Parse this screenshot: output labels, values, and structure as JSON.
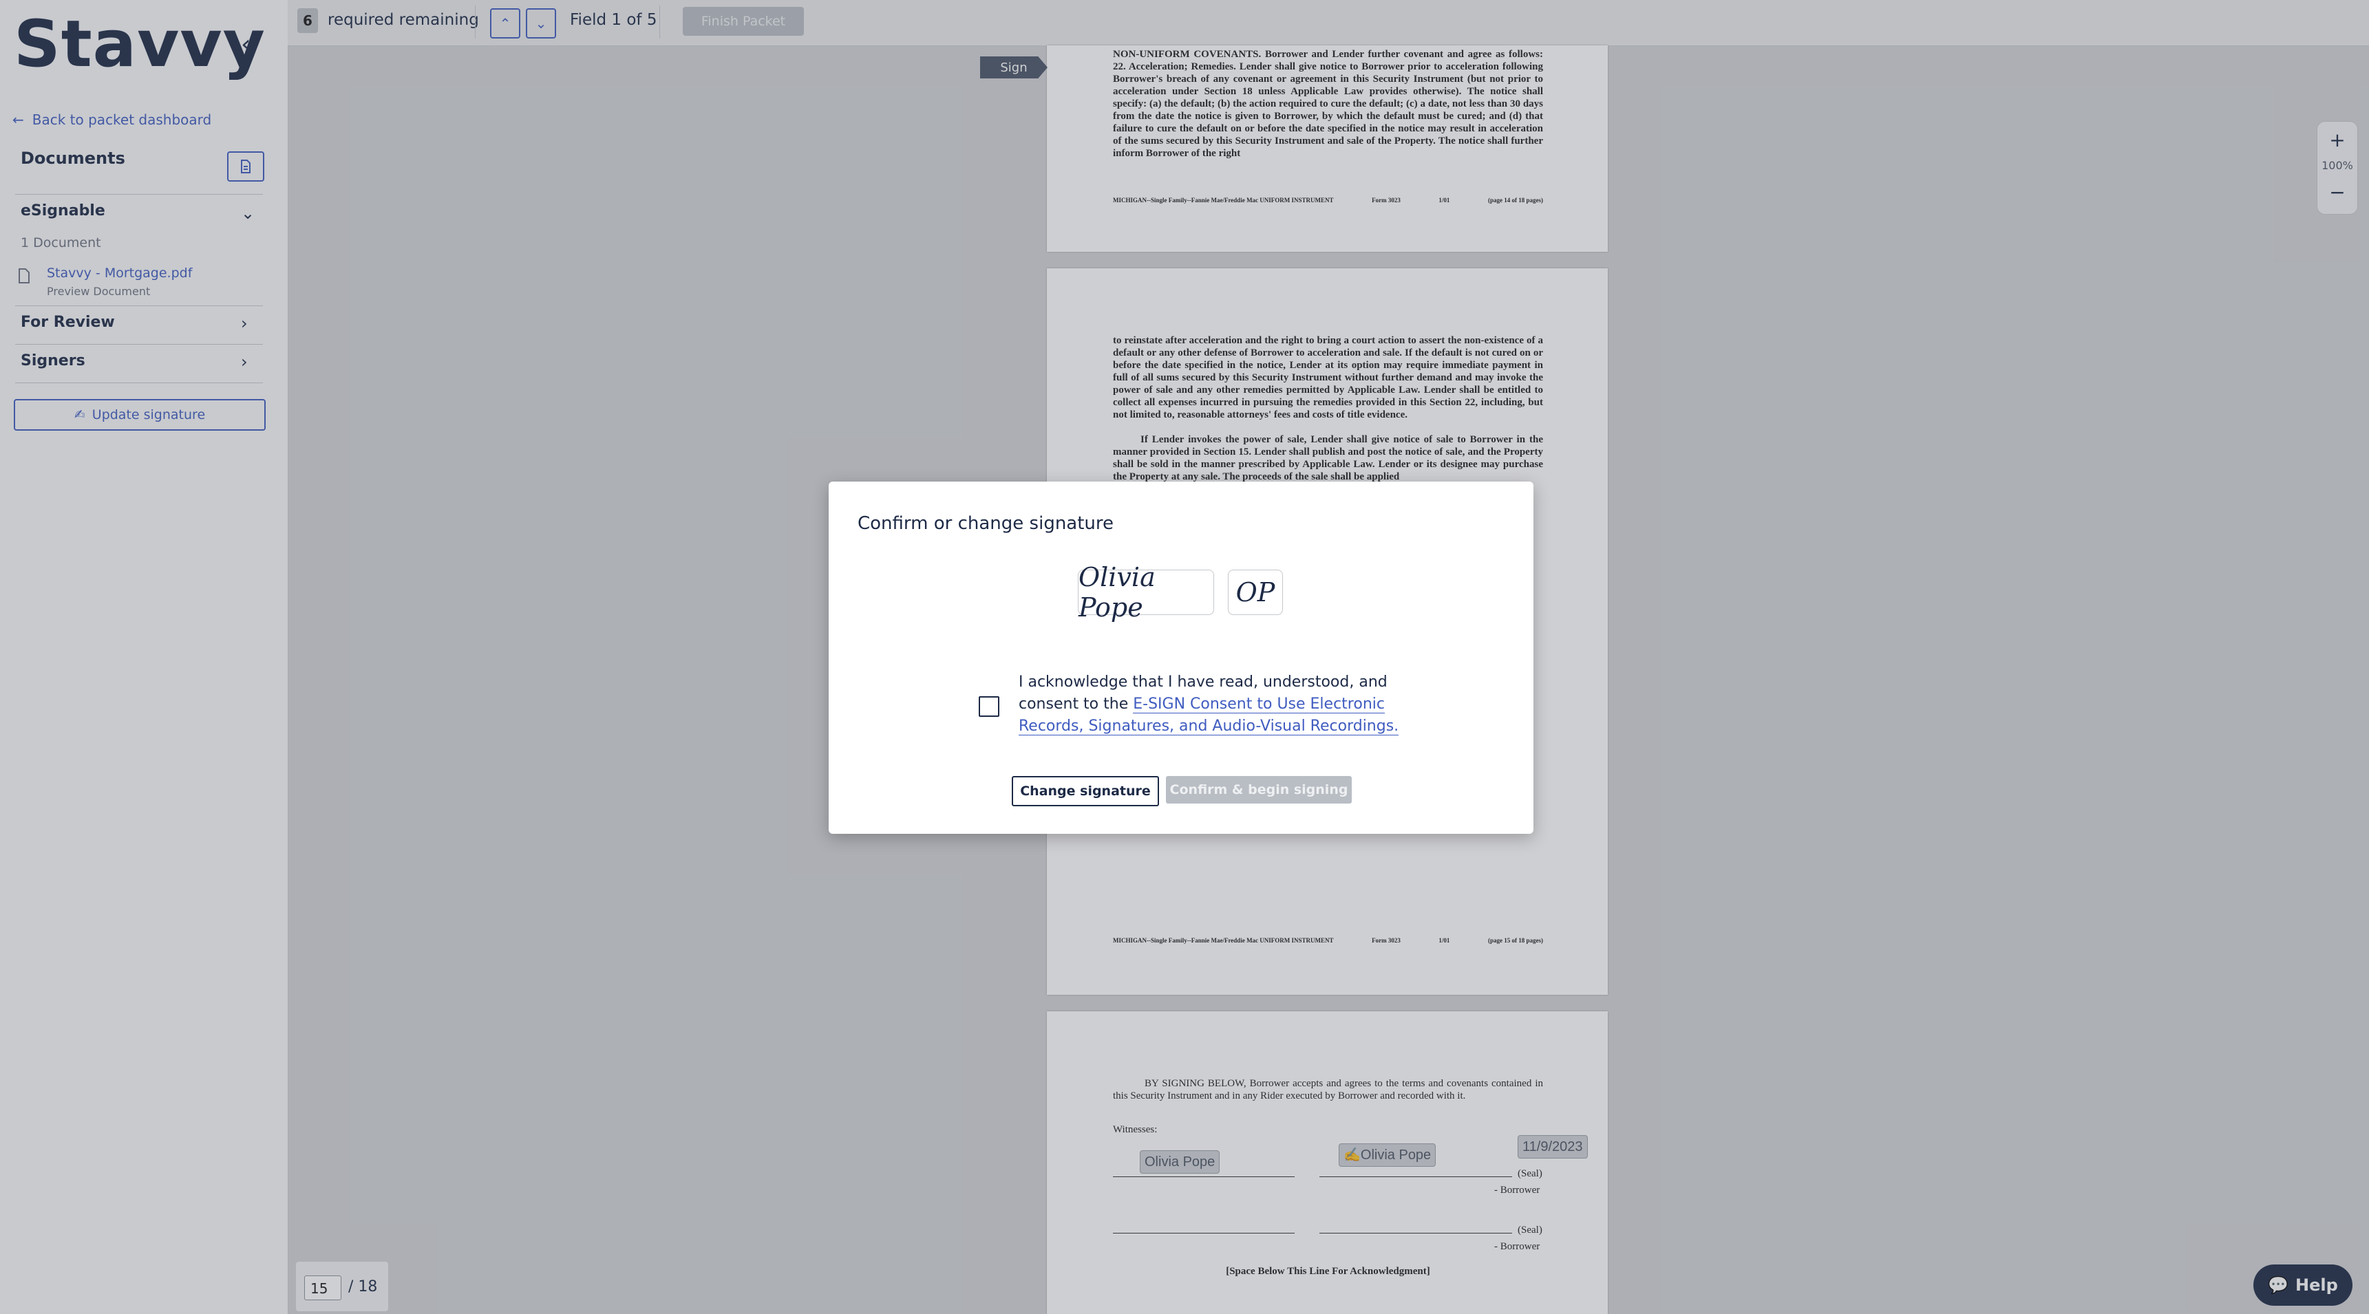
{
  "app": {
    "logo": "Stavvy",
    "back_link": "Back to packet dashboard",
    "documents_title": "Documents"
  },
  "sidebar": {
    "esignable": {
      "title": "eSignable",
      "count": "1 Document",
      "doc_name": "Stavvy - Mortgage.pdf",
      "doc_preview": "Preview Document"
    },
    "for_review": "For Review",
    "signers": "Signers",
    "update_signature": "Update signature"
  },
  "toolbar": {
    "required_count": "6",
    "required_text": "required remaining",
    "field_text": "Field 1 of 5",
    "finish": "Finish Packet"
  },
  "document": {
    "sign_flag": "Sign",
    "page1_text": "NON-UNIFORM COVENANTS. Borrower and Lender further covenant and agree as follows: 22. Acceleration; Remedies. Lender shall give notice to Borrower prior to acceleration following Borrower's breach of any covenant or agreement in this Security Instrument (but not prior to acceleration under Section 18 unless Applicable Law provides otherwise). The notice shall specify: (a) the default; (b) the action required to cure the default; (c) a date, not less than 30 days from the date the notice is given to Borrower, by which the default must be cured; and (d) that failure to cure the default on or before the date specified in the notice may result in acceleration of the sums secured by this Security Instrument and sale of the Property. The notice shall further inform Borrower of the right",
    "page1_footer_left": "MICHIGAN--Single Family--Fannie Mae/Freddie Mac UNIFORM INSTRUMENT",
    "page1_footer_form": "Form 3023",
    "page1_footer_date": "1/01",
    "page1_footer_page": "(page 14 of 18 pages)",
    "page2_text": "to reinstate after acceleration and the right to bring a court action to assert the non-existence of a default or any other defense of Borrower to acceleration and sale. If the default is not cured on or before the date specified in the notice, Lender at its option may require immediate payment in full of all sums secured by this Security Instrument without further demand and may invoke the power of sale and any other remedies permitted by Applicable Law. Lender shall be entitled to collect all expenses incurred in pursuing the remedies provided in this Section 22, including, but not limited to, reasonable attorneys' fees and costs of title evidence.",
    "page2_text_b": "If Lender invokes the power of sale, Lender shall give notice of sale to Borrower in the manner provided in Section 15. Lender shall publish and post the notice of sale, and the Property shall be sold in the manner prescribed by Applicable Law. Lender or its designee may purchase the Property at any sale. The proceeds of the sale shall be applied",
    "page2_footer_page": "(page 15 of 18 pages)",
    "page3_text": "BY SIGNING BELOW, Borrower accepts and agrees to the terms and covenants contained in this Security Instrument and in any Rider executed by Borrower and recorded with it.",
    "witnesses": "Witnesses:",
    "witness_tag": "Olivia Pope",
    "borrower_tag": "Olivia Pope",
    "date_tag": "11/9/2023",
    "seal": "(Seal)",
    "borrower_label": "- Borrower",
    "ack_line": "[Space Below This Line For Acknowledgment]"
  },
  "zoom": {
    "plus": "+",
    "level": "100%",
    "minus": "−"
  },
  "pager": {
    "current": "15",
    "total": "/ 18"
  },
  "help": "Help",
  "modal": {
    "title": "Confirm or change signature",
    "signature": "Olivia Pope",
    "initials": "OP",
    "ack_prefix": "I acknowledge that I have read, understood, and consent to the",
    "ack_link": "E-SIGN Consent to Use Electronic Records, Signatures, and Audio-Visual Recordings.",
    "change_btn": "Change signature",
    "confirm_btn": "Confirm & begin signing"
  }
}
